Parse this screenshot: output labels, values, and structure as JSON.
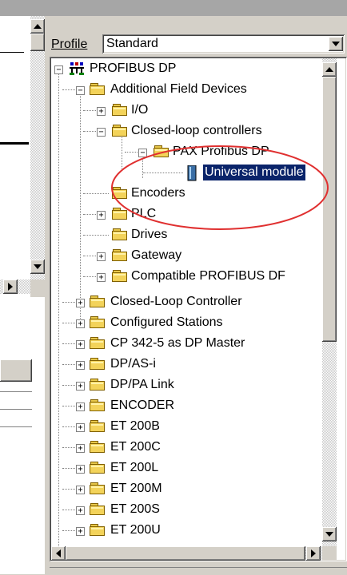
{
  "profile": {
    "label": "Profile",
    "value": "Standard"
  },
  "tree": {
    "root": "PROFIBUS DP",
    "items": [
      {
        "label": "Additional Field Devices"
      },
      {
        "label": "I/O"
      },
      {
        "label": "Closed-loop controllers"
      },
      {
        "label": "PAX Profibus DP"
      },
      {
        "label": "Universal module"
      },
      {
        "label": "Encoders"
      },
      {
        "label": "PLC"
      },
      {
        "label": "Drives"
      },
      {
        "label": "Gateway"
      },
      {
        "label": "Compatible PROFIBUS DF"
      },
      {
        "label": "Closed-Loop Controller"
      },
      {
        "label": "Configured Stations"
      },
      {
        "label": "CP 342-5 as DP Master"
      },
      {
        "label": "DP/AS-i"
      },
      {
        "label": "DP/PA Link"
      },
      {
        "label": "ENCODER"
      },
      {
        "label": "ET 200B"
      },
      {
        "label": "ET 200C"
      },
      {
        "label": "ET 200L"
      },
      {
        "label": "ET 200M"
      },
      {
        "label": "ET 200S"
      },
      {
        "label": "ET 200U"
      }
    ]
  },
  "colors": {
    "selection": "#0a246a",
    "annotation": "#e03030",
    "folder": "#f3d35a"
  }
}
